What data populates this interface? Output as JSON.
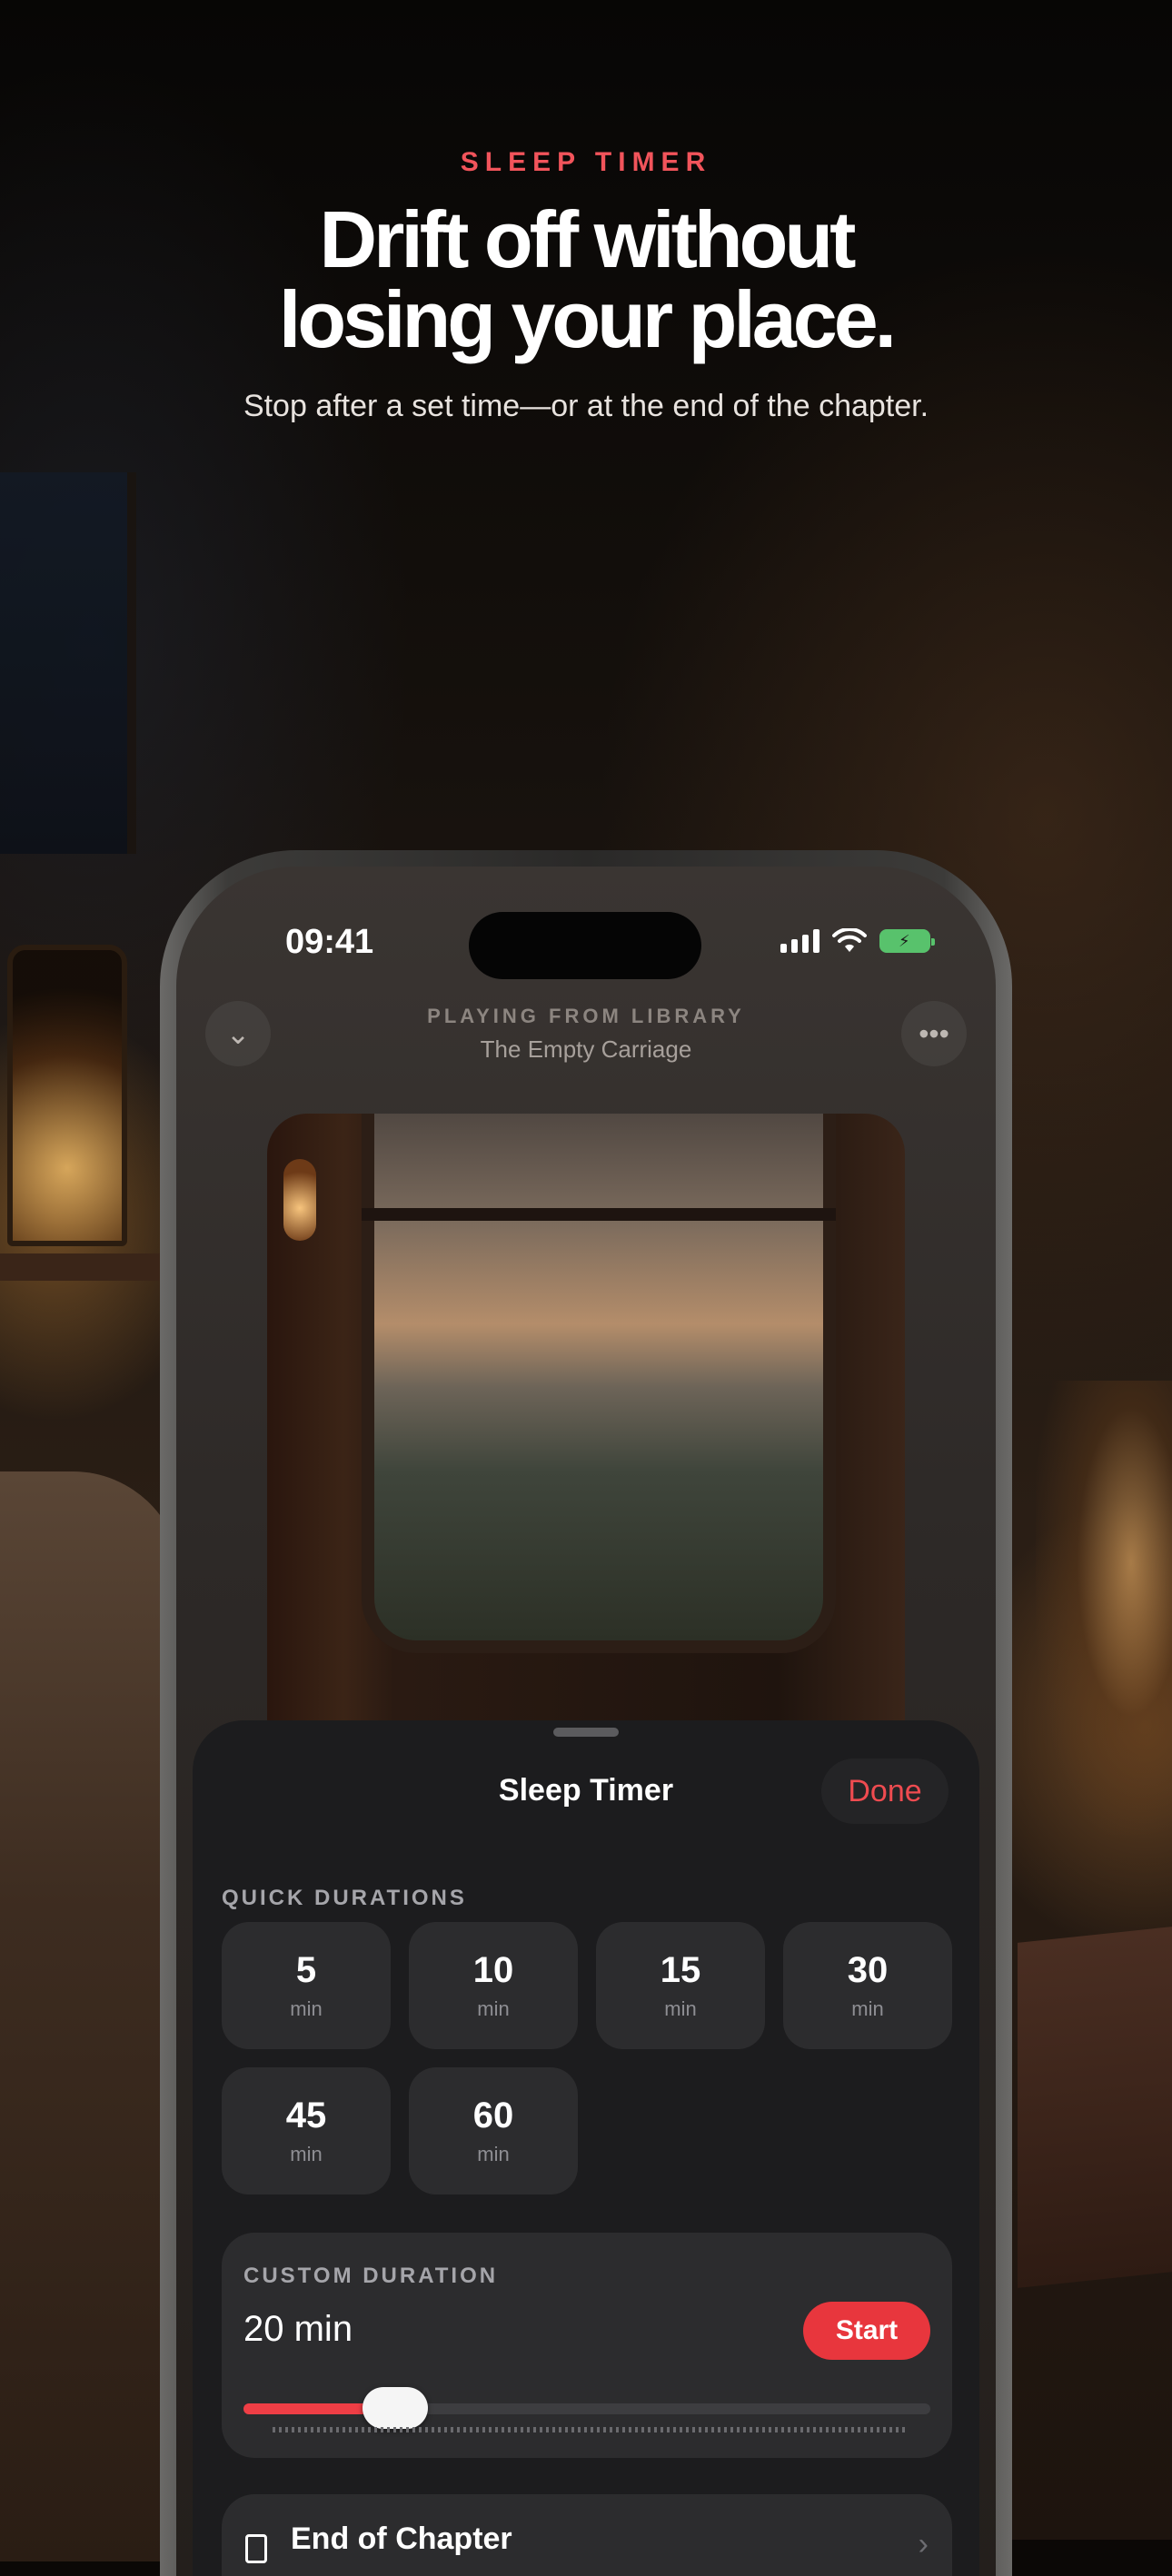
{
  "header": {
    "eyebrow": "SLEEP TIMER",
    "headline_line1": "Drift off without",
    "headline_line2": "losing your place.",
    "subhead": "Stop after a set time—or at the end of the chapter."
  },
  "status_bar": {
    "time": "09:41",
    "icons": [
      "signal-icon",
      "wifi-icon",
      "battery-charging-icon"
    ]
  },
  "now_playing": {
    "context_label": "PLAYING FROM LIBRARY",
    "title": "The Empty Carriage",
    "collapse_icon": "chevron-down-icon",
    "more_icon": "ellipsis-icon"
  },
  "sheet": {
    "title": "Sleep Timer",
    "done_label": "Done",
    "quick_label": "QUICK DURATIONS",
    "quick_durations": [
      {
        "value": "5",
        "unit": "min"
      },
      {
        "value": "10",
        "unit": "min"
      },
      {
        "value": "15",
        "unit": "min"
      },
      {
        "value": "30",
        "unit": "min"
      },
      {
        "value": "45",
        "unit": "min"
      },
      {
        "value": "60",
        "unit": "min"
      }
    ],
    "custom_label": "CUSTOM DURATION",
    "custom_value": "20 min",
    "start_label": "Start",
    "slider_fraction": 0.12,
    "end_of_chapter_label": "End of Chapter"
  },
  "colors": {
    "accent": "#ef4b50",
    "start_button": "#e8363d",
    "sheet_bg": "#1c1c1e",
    "card_bg": "#2c2c2e",
    "battery": "#58c26c"
  }
}
